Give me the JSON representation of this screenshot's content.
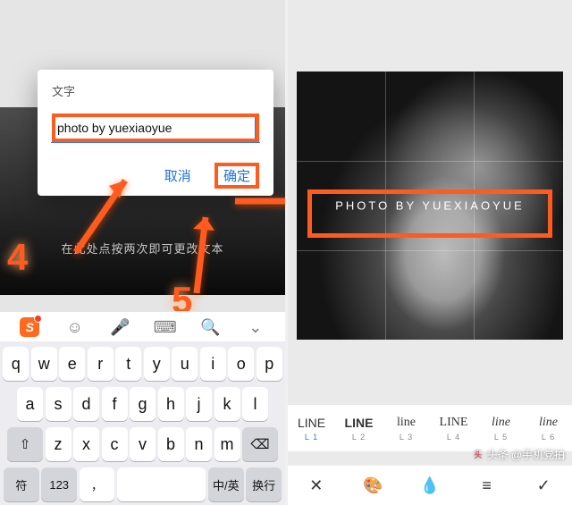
{
  "dialog": {
    "title": "文字",
    "input_value": "photo by yuexiaoyue",
    "cancel": "取消",
    "ok": "确定"
  },
  "hint": "在此处点按两次即可更改文本",
  "steps": {
    "s4": "4",
    "s5": "5"
  },
  "kbd_bar": {
    "logo": "S",
    "voice": "🎤"
  },
  "keyboard": {
    "row1": [
      "q",
      "w",
      "e",
      "r",
      "t",
      "y",
      "u",
      "i",
      "o",
      "p"
    ],
    "row2": [
      "a",
      "s",
      "d",
      "f",
      "g",
      "h",
      "j",
      "k",
      "l"
    ],
    "row3": [
      "z",
      "x",
      "c",
      "v",
      "b",
      "n",
      "m"
    ],
    "shift": "⇧",
    "back": "⌫",
    "fn_sym": "符",
    "fn_num": "123",
    "fn_comma": "，",
    "fn_lang": "中/英",
    "fn_enter": "换行"
  },
  "right": {
    "caption": "PHOTO BY YUEXIAOYUE",
    "fonts": [
      {
        "sample": "LINE",
        "ln": "L 1",
        "style": "font-weight:300"
      },
      {
        "sample": "LINE",
        "ln": "L 2",
        "style": "font-weight:700"
      },
      {
        "sample": "line",
        "ln": "L 3",
        "style": "font-family:Georgia;font-style:normal"
      },
      {
        "sample": "LINE",
        "ln": "L 4",
        "style": "font-weight:300;font-family:Georgia"
      },
      {
        "sample": "line",
        "ln": "L 5",
        "style": "font-style:italic;font-family:Georgia"
      },
      {
        "sample": "line",
        "ln": "L 6",
        "style": "font-family:cursive;font-style:italic"
      }
    ],
    "toolbar": {
      "close": "✕",
      "palette": "🎨",
      "drop": "💧",
      "align": "≡",
      "check": "✓"
    }
  },
  "watermark": {
    "prefix": "头条",
    "account": "@手机党拍"
  }
}
